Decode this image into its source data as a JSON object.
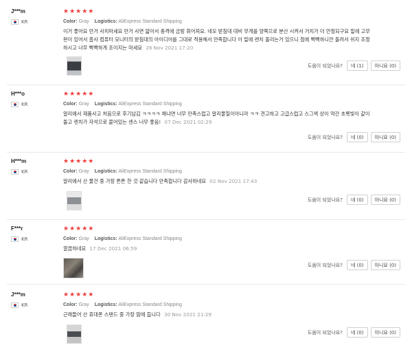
{
  "labels": {
    "color": "Color:",
    "logistics": "Logistics:",
    "helpful": "도움이 되었나요?"
  },
  "stars": "★★★★★",
  "reviews": [
    {
      "user": "J***m",
      "country": "KR",
      "color": "Gray",
      "shipping": "AliExpress Standard Shipping",
      "text": "이거 좋아요 만거 사치마세요 만거 사면 얇아서 충격에 금방 휘어져요. 네모 받침대 대비 무게를 양쪽으로 분산 시켜서 거치가 더 안정되구요 밑에 고무 판이 있어서 흠사 컴퓨터 모니터의 받침대의 아이디어를 그대로 적용해서 만족합니다 아 밑에 렌치 돌리는거 있으니 첨에 뻑뻑하니깐 돌려서 쉬지 조정하시고 너무 빡빡하게 조이지는 마세요",
      "date": "26 Nov 2021 17:20",
      "yes": "네 (1)",
      "no": "아니요 (0)",
      "photo_color": "#8a8f95"
    },
    {
      "user": "H***o",
      "country": "KR",
      "color": "Gray",
      "shipping": "AliExpress Standard Shipping",
      "text": "알리에서 제품사고 처음으로 후기남김 ㅋㅋㅋㅋ 왜냐면 너무 만족스럽고 알리물질이아니라 ㅋㅋ 견고하고 고급스럽고 스그색 상이 약간 초록빛이 같이 돌고 렌치가 자석으로 붙어있는 센스 너무 좋음!",
      "date": "07 Dec 2021 02:29",
      "yes": "네 (0)",
      "no": "아니요 (0)",
      "photo_color": ""
    },
    {
      "user": "H***m",
      "country": "KR",
      "color": "Gray",
      "shipping": "AliExpress Standard Shipping",
      "text": "알리에서 산 물건 중 가장 튼튼 한 것 같습니다 만족합니다 감사하네요",
      "date": "02 Nov 2021 17:43",
      "yes": "네 (0)",
      "no": "아니요 (0)",
      "photo_color": "#b5b8bb"
    },
    {
      "user": "F***r",
      "country": "KR",
      "color": "Gray",
      "shipping": "AliExpress Standard Shipping",
      "text": "깔끔하네요",
      "date": "17 Dec 2021 06:59",
      "yes": "네 (0)",
      "no": "아니요 (0)",
      "photo_color": "#6f6a62"
    },
    {
      "user": "J***m",
      "country": "KR",
      "color": "Gray",
      "shipping": "AliExpress Standard Shipping",
      "text": "근래들어 산 휴대폰 스탠드 중 가장 맘에 듭니다",
      "date": "30 Nov 2021 21:29",
      "yes": "네 (0)",
      "no": "아니요 (0)",
      "photo_color": "#9c9c9c"
    }
  ]
}
